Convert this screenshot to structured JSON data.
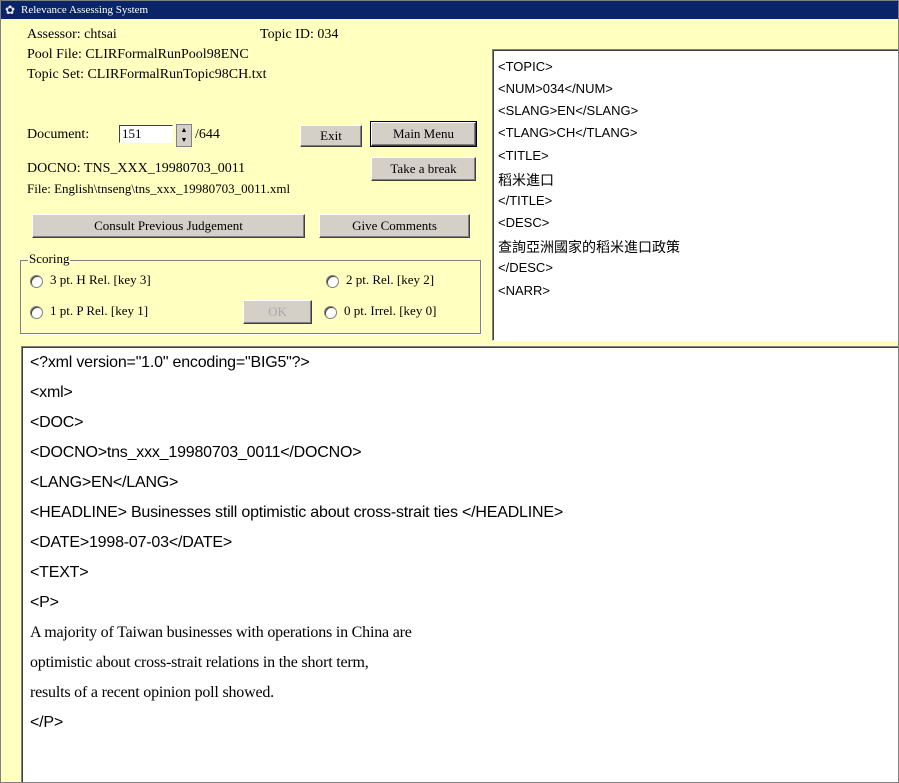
{
  "window": {
    "title": "Relevance Assessing System",
    "icon": "app-icon"
  },
  "info": {
    "assessor": "Assessor: chtsai",
    "topic_id": "Topic ID: 034",
    "pool_file": "Pool File: CLIRFormalRunPool98ENC",
    "topic_set": "Topic Set: CLIRFormalRunTopic98CH.txt",
    "document_label": "Document:",
    "document_value": "151",
    "document_total": "/644",
    "docno": "DOCNO: TNS_XXX_19980703_0011",
    "file": "File: English\\tnseng\\tns_xxx_19980703_0011.xml"
  },
  "buttons": {
    "exit": "Exit",
    "main_menu": "Main Menu",
    "take_break": "Take a break",
    "consult": "Consult Previous Judgement",
    "comments": "Give Comments",
    "ok": "OK"
  },
  "scoring": {
    "legend": "Scoring",
    "options": [
      {
        "label": "3 pt. H Rel. [key 3]",
        "selected": false
      },
      {
        "label": "2 pt. Rel. [key 2]",
        "selected": false
      },
      {
        "label": "1 pt. P Rel. [key 1]",
        "selected": false
      },
      {
        "label": "0 pt. Irrel. [key 0]",
        "selected": false
      }
    ]
  },
  "topic_lines": [
    "<TOPIC>",
    "<NUM>034</NUM>",
    "<SLANG>EN</SLANG>",
    "<TLANG>CH</TLANG>",
    "<TITLE>",
    "稻米進口",
    "</TITLE>",
    "<DESC>",
    "查詢亞洲國家的稻米進口政策",
    "</DESC>",
    "<NARR>"
  ],
  "doc_lines": [
    "<?xml version=\"1.0\" encoding=\"BIG5\"?>",
    "<xml>",
    "<DOC>",
    "<DOCNO>tns_xxx_19980703_0011</DOCNO>",
    "<LANG>EN</LANG>",
    "<HEADLINE> Businesses still optimistic about cross-strait ties </HEADLINE>",
    "<DATE>1998-07-03</DATE>",
    "<TEXT>",
    "<P>",
    " A majority of Taiwan businesses with operations in China are",
    " optimistic about cross-strait relations in the short term,",
    " results of a recent opinion poll showed.",
    "</P>"
  ],
  "colors": {
    "panel": "#ffffbf",
    "titlebar": "#0a246a",
    "button": "#d4d0c8"
  }
}
